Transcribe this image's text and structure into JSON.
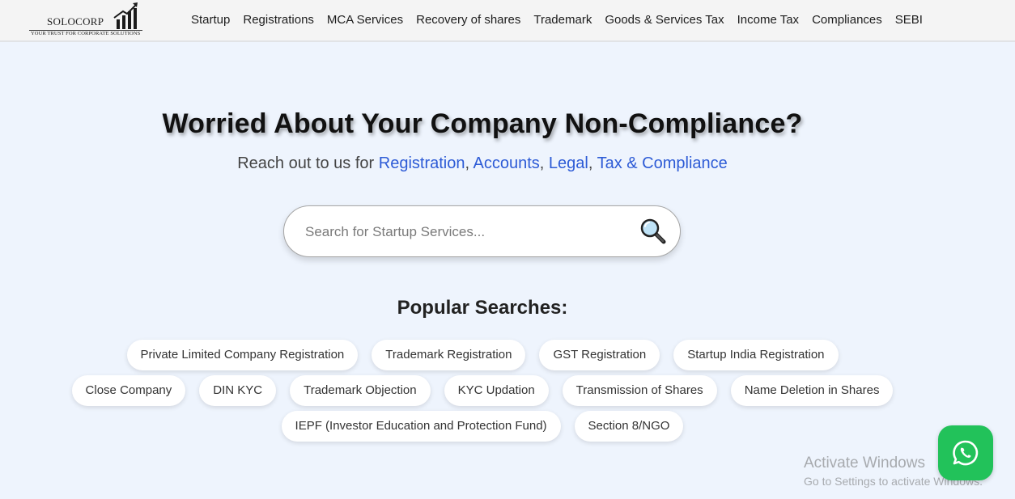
{
  "logo": {
    "name": "SOLOCORP",
    "tagline": "YOUR TRUST FOR CORPORATE SOLUTIONS"
  },
  "nav": {
    "items": [
      {
        "label": "Startup"
      },
      {
        "label": "Registrations"
      },
      {
        "label": "MCA Services"
      },
      {
        "label": "Recovery of shares"
      },
      {
        "label": "Trademark"
      },
      {
        "label": "Goods & Services Tax"
      },
      {
        "label": "Income Tax"
      },
      {
        "label": "Compliances"
      },
      {
        "label": "SEBI"
      }
    ]
  },
  "hero": {
    "headline": "Worried About Your Company Non-Compliance?",
    "sub_prefix": "Reach out to us for ",
    "links": [
      "Registration",
      "Accounts",
      "Legal",
      "Tax & Compliance"
    ],
    "separators": [
      ", ",
      ", ",
      ", "
    ]
  },
  "search": {
    "placeholder": "Search for Startup Services...",
    "value": "",
    "icon": "magnifier-icon"
  },
  "popular": {
    "title": "Popular Searches:",
    "row1": [
      "Private Limited Company Registration",
      "Trademark Registration",
      "GST Registration",
      "Startup India Registration"
    ],
    "row2": [
      "Close Company",
      "DIN KYC",
      "Trademark Objection",
      "KYC Updation",
      "Transmission of Shares",
      "Name Deletion in Shares"
    ],
    "row3": [
      "IEPF (Investor Education and Protection Fund)",
      "Section 8/NGO"
    ]
  },
  "whatsapp": {
    "icon": "whatsapp-icon",
    "color": "#22c25a"
  },
  "watermark": {
    "title": "Activate Windows",
    "subtitle": "Go to Settings to activate Windows."
  },
  "colors": {
    "accent": "#2d5bd6",
    "background": "#eef4fd"
  }
}
